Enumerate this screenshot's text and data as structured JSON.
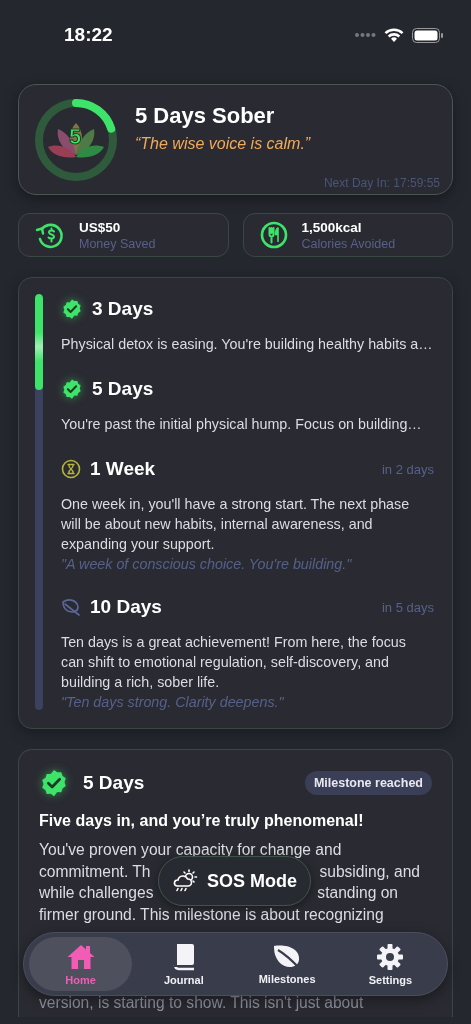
{
  "status_bar": {
    "time": "18:22"
  },
  "hero": {
    "title": "5 Days Sober",
    "day_count": "5",
    "quote": "“The wise voice is calm.”",
    "countdown": "Next Day In: 17:59:55",
    "level": 0.2
  },
  "stats": [
    {
      "kind": "money",
      "value": "US$50",
      "label": "Money Saved"
    },
    {
      "kind": "calories",
      "value": "1,500kcal",
      "label": "Calories Avoided"
    }
  ],
  "timeline": {
    "level": 0.23,
    "milestones": [
      {
        "kind": "reached",
        "title": "3 Days",
        "description": "Physical detox is easing. You're building healthy habits a…"
      },
      {
        "kind": "reached",
        "title": "5 Days",
        "description": "You're past the initial physical hump. Focus on building…"
      },
      {
        "kind": "next",
        "title": "1 Week",
        "eta": "in 2 days",
        "description": "One week in, you'll have a strong start. The next phase will be about new habits, internal awareness, and expanding your support.",
        "quote": "\"A week of conscious choice. You're building.\""
      },
      {
        "kind": "later",
        "title": "10 Days",
        "eta": "in 5 days",
        "description": "Ten days is a great achievement! From here, the focus can shift to emotional regulation, self-discovery, and building a rich, sober life.",
        "quote": "\"Ten days strong. Clarity deepens.\""
      }
    ]
  },
  "detail": {
    "title": "5 Days",
    "badge": "Milestone reached",
    "heading": "Five days in, and you’re truly phenomenal!",
    "lines": [
      [
        "You've proven your capacity for change and"
      ],
      [
        "commitment. Th",
        "subsiding, and"
      ],
      [
        "while challenges",
        "standing on"
      ],
      [
        "firmer ground. This milestone is about recognizing"
      ]
    ],
    "last_line": "version, is starting to show. This isn't just about"
  },
  "sos_button": {
    "label": "SOS Mode"
  },
  "tab_bar": [
    {
      "label": "Home",
      "selected": true
    },
    {
      "label": "Journal",
      "selected": false
    },
    {
      "label": "Milestones",
      "selected": false
    },
    {
      "label": "Settings",
      "selected": false
    }
  ]
}
